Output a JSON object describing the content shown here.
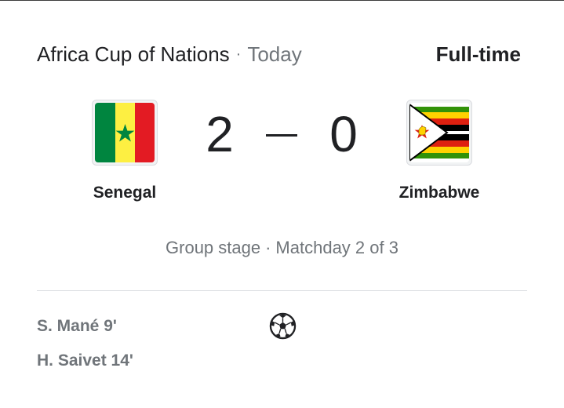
{
  "header": {
    "competition": "Africa Cup of Nations",
    "separator": "·",
    "date": "Today",
    "status": "Full-time"
  },
  "home": {
    "name": "Senegal",
    "score": "2",
    "flag_icon": "senegal-flag-icon",
    "colors": [
      "#00853F",
      "#FDEF42",
      "#E31B23"
    ]
  },
  "away": {
    "name": "Zimbabwe",
    "score": "0",
    "flag_icon": "zimbabwe-flag-icon",
    "colors": [
      "#319208",
      "#FFD200",
      "#DE2010",
      "#000000",
      "#FFFFFF"
    ]
  },
  "stage": {
    "round": "Group stage",
    "separator": "·",
    "matchday": "Matchday 2 of 3"
  },
  "goals": {
    "icon": "soccer-ball-icon",
    "scorers": [
      {
        "text": "S. Mané 9'"
      },
      {
        "text": "H. Saivet 14'"
      }
    ]
  }
}
